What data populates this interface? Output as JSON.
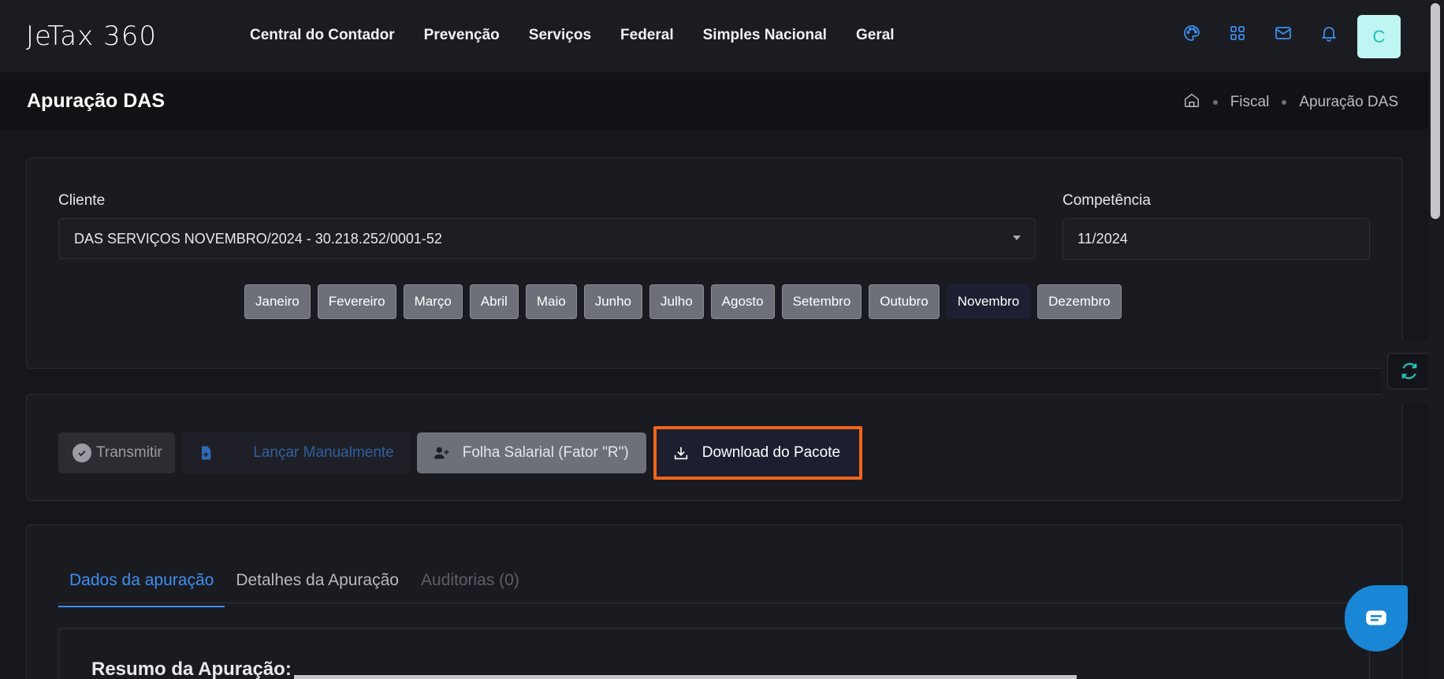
{
  "logo": "JeTax 360",
  "nav": [
    "Central do Contador",
    "Prevenção",
    "Serviços",
    "Federal",
    "Simples Nacional",
    "Geral"
  ],
  "top_icons": [
    "palette-icon",
    "grid-icon",
    "mail-icon",
    "bell-icon"
  ],
  "avatar": "C",
  "page": {
    "title": "Apuração DAS",
    "breadcrumb": [
      "Fiscal",
      "Apuração DAS"
    ]
  },
  "filters": {
    "cliente_label": "Cliente",
    "cliente_value": "DAS SERVIÇOS NOVEMBRO/2024 - 30.218.252/0001-52",
    "competencia_label": "Competência",
    "competencia_value": "11/2024"
  },
  "months": [
    "Janeiro",
    "Fevereiro",
    "Março",
    "Abril",
    "Maio",
    "Junho",
    "Julho",
    "Agosto",
    "Setembro",
    "Outubro",
    "Novembro",
    "Dezembro"
  ],
  "selected_month": "Novembro",
  "actions": {
    "transmit": "Transmitir",
    "launch": "Lançar Manualmente",
    "folha": "Folha Salarial (Fator \"R\")",
    "download": "Download do Pacote"
  },
  "tabs": [
    "Dados da apuração",
    "Detalhes da Apuração",
    "Auditorias (0)"
  ],
  "section_title": "Resumo da Apuração:",
  "colors": {
    "accent": "#3e8ef2",
    "highlight_border": "#f0651a",
    "avatar_bg": "#bff5f2",
    "chat": "#1a86d6"
  }
}
